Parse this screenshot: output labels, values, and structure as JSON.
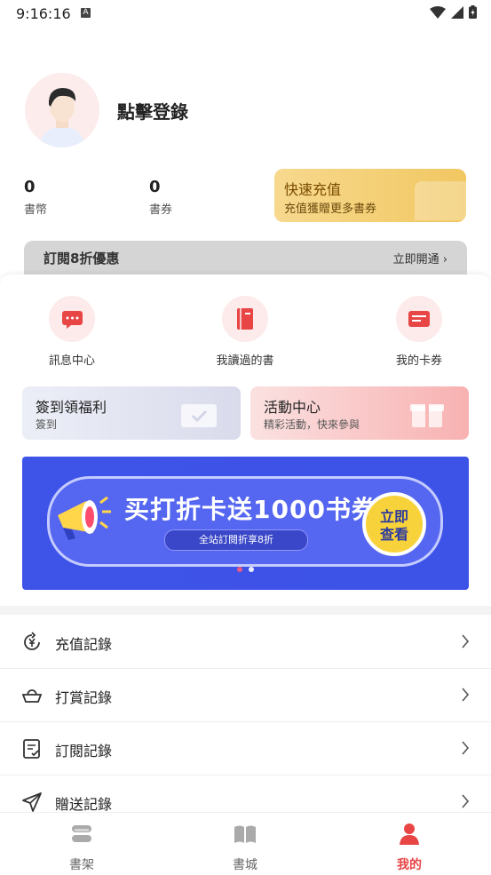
{
  "status_bar": {
    "time": "9:16:16",
    "a_label": "A"
  },
  "profile": {
    "login_text": "點擊登錄"
  },
  "stats": [
    {
      "value": "0",
      "label": "書幣"
    },
    {
      "value": "0",
      "label": "書券"
    }
  ],
  "recharge": {
    "title": "快速充值",
    "subtitle": "充值獲贈更多書券"
  },
  "subscription_banner": {
    "title": "訂閱8折優惠",
    "action": "立即開通"
  },
  "quick_actions": [
    {
      "label": "訊息中心",
      "icon": "message-icon"
    },
    {
      "label": "我讀過的書",
      "icon": "book-icon"
    },
    {
      "label": "我的卡券",
      "icon": "coupon-icon"
    }
  ],
  "cards": [
    {
      "title": "簽到領福利",
      "subtitle": "簽到"
    },
    {
      "title": "活動中心",
      "subtitle": "精彩活動，快來參與"
    }
  ],
  "promo_banner": {
    "headline": "买打折卡送1000书券",
    "subline": "全站訂閱折享8折",
    "cta": [
      "立即",
      "查看"
    ],
    "active_slide": 1,
    "slide_count": 2
  },
  "menu": [
    {
      "label": "充值記錄",
      "icon": "yen-refresh-icon"
    },
    {
      "label": "打賞記錄",
      "icon": "ingot-icon"
    },
    {
      "label": "訂閱記錄",
      "icon": "document-check-icon"
    },
    {
      "label": "贈送記錄",
      "icon": "paper-plane-icon"
    }
  ],
  "bottom_nav": [
    {
      "label": "書架",
      "icon": "bookshelf-icon",
      "active": false
    },
    {
      "label": "書城",
      "icon": "open-book-icon",
      "active": false
    },
    {
      "label": "我的",
      "icon": "person-icon",
      "active": true
    }
  ],
  "colors": {
    "accent": "#e84545",
    "gold": "#f1c761",
    "promo_blue": "#3e53e8"
  }
}
